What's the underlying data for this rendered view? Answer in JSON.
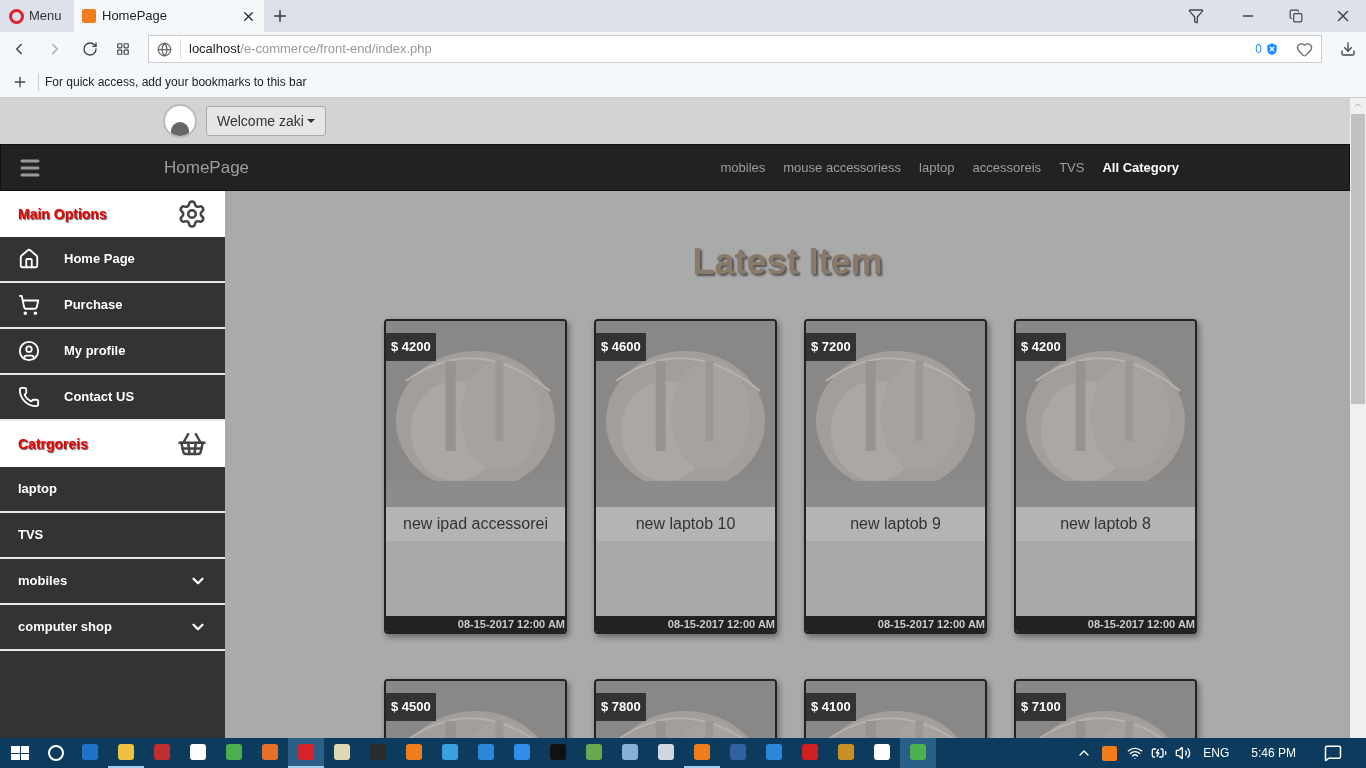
{
  "browser": {
    "menu_label": "Menu",
    "tabs": [
      {
        "title": "HomePage",
        "selected": true
      }
    ],
    "url": {
      "host": "localhost",
      "path": "/e-commerce/front-end/index.php"
    },
    "blocked_count": "0",
    "bookmarks_hint": "For quick access, add your bookmarks to this bar"
  },
  "user_bar": {
    "welcome": "Welcome zaki"
  },
  "navbar": {
    "brand": "HomePage",
    "links": [
      {
        "label": "mobiles",
        "selected": false
      },
      {
        "label": "mouse accessoriess",
        "selected": false
      },
      {
        "label": "laptop",
        "selected": false
      },
      {
        "label": "accessoreis",
        "selected": false
      },
      {
        "label": "TVS",
        "selected": false
      },
      {
        "label": "All Category",
        "selected": true
      }
    ]
  },
  "sidebar": {
    "sections": [
      {
        "title": "Main Options",
        "kind": "gears",
        "items": [
          {
            "label": "Home Page",
            "kind": "home"
          },
          {
            "label": "Purchase",
            "kind": "cart"
          },
          {
            "label": "My profile",
            "kind": "profile"
          },
          {
            "label": "Contact US",
            "kind": "phone"
          }
        ]
      },
      {
        "title": "Catrgoreis",
        "kind": "basket",
        "items": [
          {
            "label": "laptop",
            "expandable": false
          },
          {
            "label": "TVS",
            "expandable": false
          },
          {
            "label": "mobiles",
            "expandable": true
          },
          {
            "label": "computer shop",
            "expandable": true
          }
        ]
      }
    ]
  },
  "content": {
    "heading": "Latest Item",
    "items": [
      {
        "price": "$ 4200",
        "name": "new ipad accessorei",
        "date": "08-15-2017 12:00 AM"
      },
      {
        "price": "$ 4600",
        "name": "new laptob 10",
        "date": "08-15-2017 12:00 AM"
      },
      {
        "price": "$ 7200",
        "name": "new laptob 9",
        "date": "08-15-2017 12:00 AM"
      },
      {
        "price": "$ 4200",
        "name": "new laptob 8",
        "date": "08-15-2017 12:00 AM"
      },
      {
        "price": "$ 4500"
      },
      {
        "price": "$ 7800"
      },
      {
        "price": "$ 4100"
      },
      {
        "price": "$ 7100"
      }
    ]
  },
  "taskbar": {
    "apps": [
      {
        "color": "#1e73c8",
        "open": false,
        "selected": false
      },
      {
        "color": "#f0c040",
        "open": true,
        "selected": false
      },
      {
        "color": "#c03030",
        "open": false,
        "selected": false
      },
      {
        "color": "#ffffff",
        "open": false,
        "selected": false
      },
      {
        "color": "#4caf50",
        "open": false,
        "selected": false
      },
      {
        "color": "#e8702a",
        "open": false,
        "selected": false
      },
      {
        "color": "#d8232a",
        "open": true,
        "selected": true
      },
      {
        "color": "#e0d8b0",
        "open": false,
        "selected": false
      },
      {
        "color": "#2b2b2b",
        "open": false,
        "selected": false
      },
      {
        "color": "#f07c1c",
        "open": false,
        "selected": false
      },
      {
        "color": "#3aa0e0",
        "open": false,
        "selected": false
      },
      {
        "color": "#2a88d8",
        "open": false,
        "selected": false
      },
      {
        "color": "#2e8ee8",
        "open": false,
        "selected": false
      },
      {
        "color": "#111111",
        "open": false,
        "selected": false
      },
      {
        "color": "#6aa84f",
        "open": false,
        "selected": false
      },
      {
        "color": "#8ab0d8",
        "open": false,
        "selected": false
      },
      {
        "color": "#cfd8e0",
        "open": false,
        "selected": false
      },
      {
        "color": "#f07c1c",
        "open": true,
        "selected": false
      },
      {
        "color": "#3060a0",
        "open": false,
        "selected": false
      },
      {
        "color": "#2a88d8",
        "open": false,
        "selected": false
      },
      {
        "color": "#d02020",
        "open": false,
        "selected": false
      },
      {
        "color": "#c89020",
        "open": false,
        "selected": false
      },
      {
        "color": "#ffffff",
        "open": false,
        "selected": false
      },
      {
        "color": "#4caf50",
        "open": false,
        "selected": true
      }
    ],
    "language": "ENG",
    "time": "5:46 PM"
  }
}
